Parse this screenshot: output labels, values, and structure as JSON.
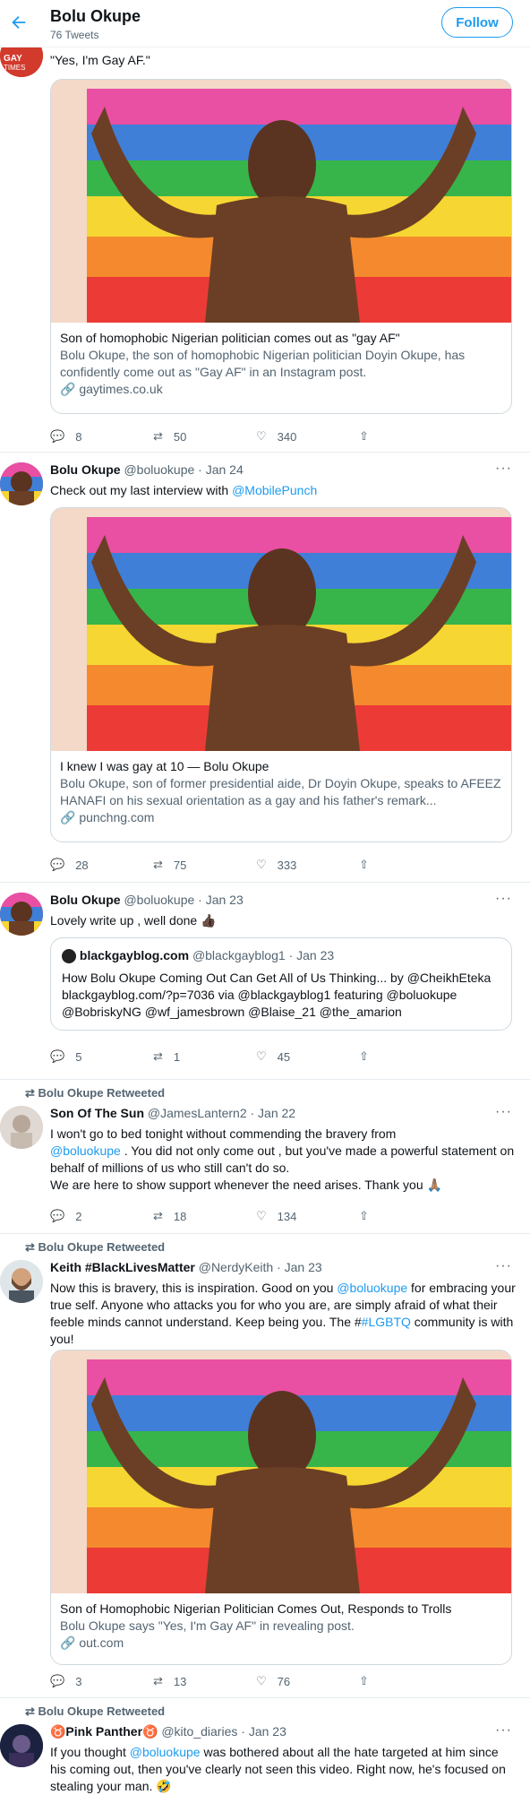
{
  "header": {
    "title": "Bolu Okupe",
    "tweet_count": "76 Tweets",
    "follow_label": "Follow"
  },
  "tweets": [
    {
      "text": "\"Yes, I'm Gay AF.\"",
      "card": {
        "title": "Son of homophobic Nigerian politician comes out as \"gay AF\"",
        "desc": "Bolu Okupe, the son of homophobic Nigerian politician Doyin Okupe, has confidently come out as \"Gay AF\" in an Instagram post.",
        "domain": "gaytimes.co.uk"
      },
      "replies": "8",
      "retweets": "50",
      "likes": "340"
    },
    {
      "name": "Bolu Okupe",
      "handle": "@boluokupe",
      "date": "· Jan 24",
      "text_prefix": "Check out my last interview with ",
      "text_link": "@MobilePunch",
      "card": {
        "title": "I knew I was gay at 10 — Bolu Okupe",
        "desc": "Bolu Okupe, son of former presidential aide, Dr Doyin Okupe, speaks to AFEEZ HANAFI on his sexual orientation as a gay and his father's remark...",
        "domain": "punchng.com"
      },
      "replies": "28",
      "retweets": "75",
      "likes": "333"
    },
    {
      "name": "Bolu Okupe",
      "handle": "@boluokupe",
      "date": "· Jan 23",
      "text": "Lovely write up , well done 👍🏿",
      "quote": {
        "name": "blackgayblog.com",
        "handle": "@blackgayblog1",
        "date": "· Jan 23",
        "text": "How Bolu Okupe Coming Out Can Get All of Us Thinking... by @CheikhEteka blackgayblog.com/?p=7036 via @blackgayblog1 featuring @boluokupe @BobriskyNG @wf_jamesbrown @Blaise_21 @the_amarion"
      },
      "replies": "5",
      "retweets": "1",
      "likes": "45"
    },
    {
      "retweeted_by": "Bolu Okupe Retweeted",
      "name": "Son Of The Sun",
      "handle": "@JamesLantern2",
      "date": "· Jan 22",
      "text_line1": "I won't go to bed tonight without commending the bravery from",
      "text_link": "@boluokupe",
      "text_rest": " . You did not only come out , but you've made a powerful statement on behalf of millions of us who still can't do so.",
      "text_line3": "We are here to show support whenever the need arises. Thank you 🙏🏽",
      "replies": "2",
      "retweets": "18",
      "likes": "134"
    },
    {
      "retweeted_by": "Bolu Okupe Retweeted",
      "name": "Keith #BlackLivesMatter",
      "handle": "@NerdyKeith",
      "date": "· Jan 23",
      "text_a": "Now this is bravery, this is inspiration. Good on you ",
      "text_link": "@boluokupe",
      "text_b": " for embracing your true self. Anyone who attacks you for who you are, are simply afraid of what their feeble minds cannot understand. Keep being you. The #",
      "text_link2": "#LGBTQ",
      "text_c": " community is with you!",
      "card": {
        "title": "Son of Homophobic Nigerian Politician Comes Out, Responds to Trolls",
        "desc": "Bolu Okupe says \"Yes, I'm Gay AF\" in revealing post.",
        "domain": "out.com"
      },
      "replies": "3",
      "retweets": "13",
      "likes": "76"
    },
    {
      "retweeted_by": "Bolu Okupe Retweeted",
      "name": "♉Pink Panther♉",
      "handle": "@kito_diaries",
      "date": "· Jan 23",
      "text_a": "If you thought ",
      "text_link": "@boluokupe",
      "text_b": " was bothered about all the hate targeted at him since his coming out, then you've clearly not seen this video. Right now, he's focused on stealing your man. 🤣"
    }
  ],
  "colors": {
    "accent": "#1d9bf0",
    "muted": "#536471",
    "border": "#cfd9de"
  }
}
